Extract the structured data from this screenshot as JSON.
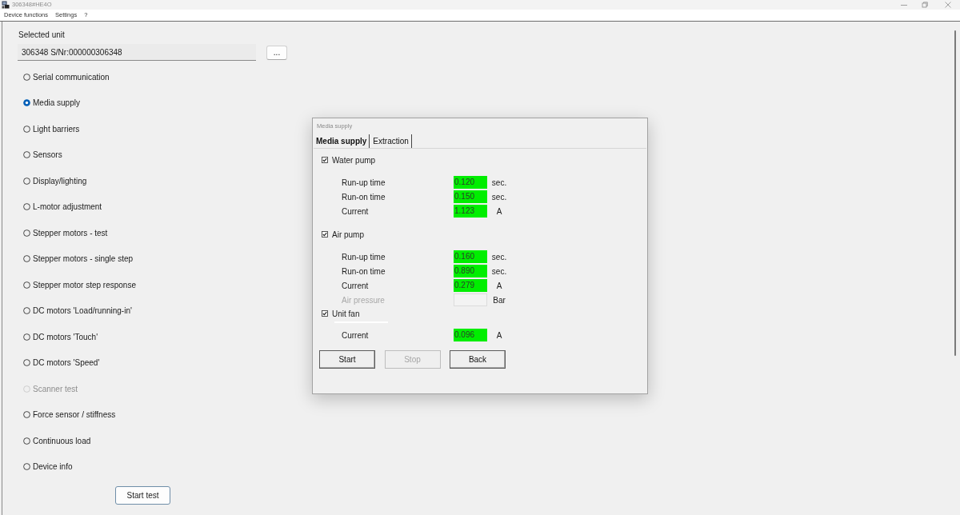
{
  "window": {
    "title": "306348#HE4O"
  },
  "menu": [
    {
      "label": "Device functions"
    },
    {
      "label": "Settings"
    },
    {
      "label": "?"
    }
  ],
  "selected_unit": {
    "label": "Selected unit",
    "value": "306348 S/Nr:000000306348",
    "browse_button": "..."
  },
  "tests": [
    {
      "label": "Serial communication",
      "selected": false,
      "disabled": false
    },
    {
      "label": "Media supply",
      "selected": true,
      "disabled": false
    },
    {
      "label": "Light barriers",
      "selected": false,
      "disabled": false
    },
    {
      "label": "Sensors",
      "selected": false,
      "disabled": false
    },
    {
      "label": "Display/lighting",
      "selected": false,
      "disabled": false
    },
    {
      "label": "L-motor adjustment",
      "selected": false,
      "disabled": false
    },
    {
      "label": "Stepper motors - test",
      "selected": false,
      "disabled": false
    },
    {
      "label": "Stepper motors - single step",
      "selected": false,
      "disabled": false
    },
    {
      "label": "Stepper motor step response",
      "selected": false,
      "disabled": false
    },
    {
      "label": "DC motors 'Load/running-in'",
      "selected": false,
      "disabled": false
    },
    {
      "label": "DC motors 'Touch'",
      "selected": false,
      "disabled": false
    },
    {
      "label": "DC motors 'Speed'",
      "selected": false,
      "disabled": false
    },
    {
      "label": "Scanner test",
      "selected": false,
      "disabled": true
    },
    {
      "label": "Force sensor / stiffness",
      "selected": false,
      "disabled": false
    },
    {
      "label": "Continuous load",
      "selected": false,
      "disabled": false
    },
    {
      "label": "Device info",
      "selected": false,
      "disabled": false
    }
  ],
  "start_button": "Start test",
  "dialog": {
    "title": "Media supply",
    "tabs": [
      {
        "label": "Media supply",
        "selected": true
      },
      {
        "label": "Extraction",
        "selected": false
      }
    ],
    "groups": [
      {
        "label": "Water pump",
        "checked": true,
        "rows": [
          {
            "label": "Run-up time",
            "value": "0.120",
            "unit": "sec.",
            "highlighted": true,
            "disabled": false
          },
          {
            "label": "Run-on time",
            "value": "0.150",
            "unit": "sec.",
            "highlighted": true,
            "disabled": false
          },
          {
            "label": "Current",
            "value": "1.123",
            "unit": "A",
            "highlighted": true,
            "disabled": false
          }
        ]
      },
      {
        "label": "Air pump",
        "checked": true,
        "rows": [
          {
            "label": "Run-up time",
            "value": "0.160",
            "unit": "sec.",
            "highlighted": true,
            "disabled": false
          },
          {
            "label": "Run-on time",
            "value": "0.890",
            "unit": "sec.",
            "highlighted": true,
            "disabled": false
          },
          {
            "label": "Current",
            "value": "0.279",
            "unit": "A",
            "highlighted": true,
            "disabled": false
          },
          {
            "label": "Air pressure",
            "unit": "Bar",
            "highlighted": false,
            "disabled": true
          }
        ]
      },
      {
        "label": "Unit fan",
        "checked": true,
        "divider": true,
        "rows": [
          {
            "label": "Current",
            "value": "0.096",
            "unit": "A",
            "highlighted": true,
            "disabled": false
          }
        ]
      }
    ],
    "buttons": [
      {
        "label": "Start",
        "disabled": false
      },
      {
        "label": "Stop",
        "disabled": true
      },
      {
        "label": "Back",
        "disabled": false
      }
    ]
  }
}
